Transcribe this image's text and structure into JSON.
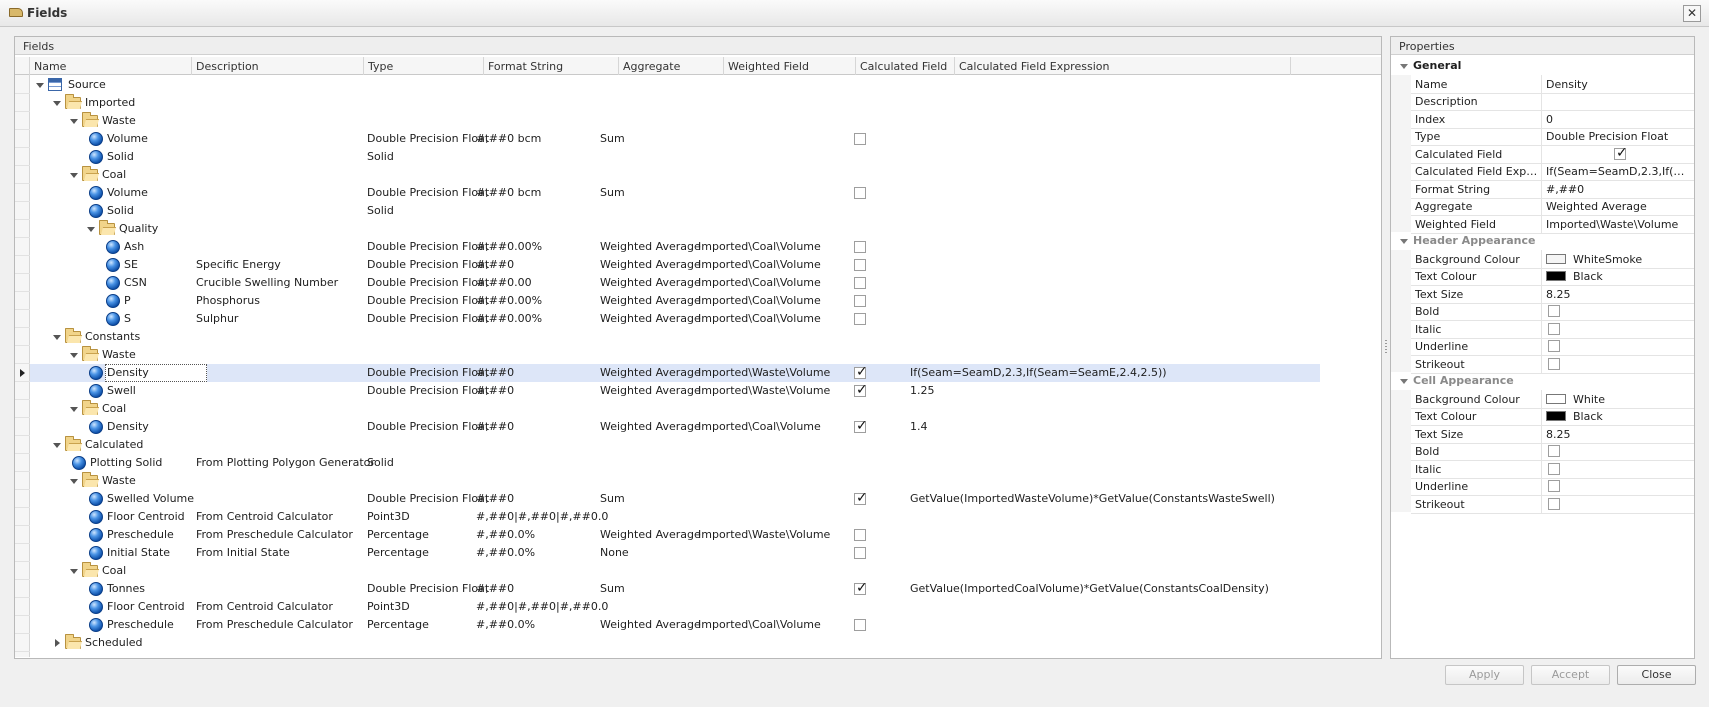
{
  "window": {
    "title": "Fields",
    "close_glyph": "✕"
  },
  "fields_panel": {
    "title": "Fields",
    "columns": [
      "Name",
      "Description",
      "Type",
      "Format String",
      "Aggregate",
      "Weighted Field",
      "Calculated Field",
      "Calculated Field Expression"
    ]
  },
  "tree_rows": [
    {
      "name": "Source",
      "level": 0,
      "kind": "table",
      "expander": "open"
    },
    {
      "name": "Imported",
      "level": 1,
      "kind": "folder",
      "expander": "open"
    },
    {
      "name": "Waste",
      "level": 2,
      "kind": "folder",
      "expander": "open"
    },
    {
      "name": "Volume",
      "level": 3,
      "kind": "field",
      "type": "Double Precision Float",
      "format": "#,##0 bcm",
      "aggregate": "Sum",
      "calc": false
    },
    {
      "name": "Solid",
      "level": 3,
      "kind": "field",
      "type": "Solid"
    },
    {
      "name": "Coal",
      "level": 2,
      "kind": "folder",
      "expander": "open"
    },
    {
      "name": "Volume",
      "level": 3,
      "kind": "field",
      "type": "Double Precision Float",
      "format": "#,##0 bcm",
      "aggregate": "Sum",
      "calc": false
    },
    {
      "name": "Solid",
      "level": 3,
      "kind": "field",
      "type": "Solid"
    },
    {
      "name": "Quality",
      "level": 3,
      "kind": "folder",
      "expander": "open"
    },
    {
      "name": "Ash",
      "level": 4,
      "kind": "field",
      "type": "Double Precision Float",
      "format": "#,##0.00%",
      "aggregate": "Weighted Average",
      "weighted": "Imported\\Coal\\Volume",
      "calc": false
    },
    {
      "name": "SE",
      "level": 4,
      "kind": "field",
      "description": "Specific Energy",
      "type": "Double Precision Float",
      "format": "#,##0",
      "aggregate": "Weighted Average",
      "weighted": "Imported\\Coal\\Volume",
      "calc": false
    },
    {
      "name": "CSN",
      "level": 4,
      "kind": "field",
      "description": "Crucible Swelling Number",
      "type": "Double Precision Float",
      "format": "#,##0.00",
      "aggregate": "Weighted Average",
      "weighted": "Imported\\Coal\\Volume",
      "calc": false
    },
    {
      "name": "P",
      "level": 4,
      "kind": "field",
      "description": "Phosphorus",
      "type": "Double Precision Float",
      "format": "#,##0.00%",
      "aggregate": "Weighted Average",
      "weighted": "Imported\\Coal\\Volume",
      "calc": false
    },
    {
      "name": "S",
      "level": 4,
      "kind": "field",
      "description": "Sulphur",
      "type": "Double Precision Float",
      "format": "#,##0.00%",
      "aggregate": "Weighted Average",
      "weighted": "Imported\\Coal\\Volume",
      "calc": false
    },
    {
      "name": "Constants",
      "level": 1,
      "kind": "folder",
      "expander": "open"
    },
    {
      "name": "Waste",
      "level": 2,
      "kind": "folder",
      "expander": "open"
    },
    {
      "name": "Density",
      "level": 3,
      "kind": "field",
      "type": "Double Precision Float",
      "format": "#,##0",
      "aggregate": "Weighted Average",
      "weighted": "Imported\\Waste\\Volume",
      "calc": true,
      "expression": "If(Seam=SeamD,2.3,If(Seam=SeamE,2.4,2.5))",
      "selected": true
    },
    {
      "name": "Swell",
      "level": 3,
      "kind": "field",
      "type": "Double Precision Float",
      "format": "#,##0",
      "aggregate": "Weighted Average",
      "weighted": "Imported\\Waste\\Volume",
      "calc": true,
      "expression": "1.25"
    },
    {
      "name": "Coal",
      "level": 2,
      "kind": "folder",
      "expander": "open"
    },
    {
      "name": "Density",
      "level": 3,
      "kind": "field",
      "type": "Double Precision Float",
      "format": "#,##0",
      "aggregate": "Weighted Average",
      "weighted": "Imported\\Coal\\Volume",
      "calc": true,
      "expression": "1.4"
    },
    {
      "name": "Calculated",
      "level": 1,
      "kind": "folder",
      "expander": "open"
    },
    {
      "name": "Plotting Solid",
      "level": 2,
      "kind": "field",
      "description": "From Plotting Polygon Generator",
      "type": "Solid"
    },
    {
      "name": "Waste",
      "level": 2,
      "kind": "folder",
      "expander": "open"
    },
    {
      "name": "Swelled Volume",
      "level": 3,
      "kind": "field",
      "type": "Double Precision Float",
      "format": "#,##0",
      "aggregate": "Sum",
      "calc": true,
      "expression": "GetValue(ImportedWasteVolume)*GetValue(ConstantsWasteSwell)"
    },
    {
      "name": "Floor Centroid",
      "level": 3,
      "kind": "field",
      "description": "From Centroid Calculator",
      "type": "Point3D",
      "format": "#,##0|#,##0|#,##0.0"
    },
    {
      "name": "Preschedule",
      "level": 3,
      "kind": "field",
      "description": "From Preschedule Calculator",
      "type": "Percentage",
      "format": "#,##0.0%",
      "aggregate": "Weighted Average",
      "weighted": "Imported\\Waste\\Volume",
      "calc": false
    },
    {
      "name": "Initial State",
      "level": 3,
      "kind": "field",
      "description": "From Initial State",
      "type": "Percentage",
      "format": "#,##0.0%",
      "aggregate": "None",
      "calc": false
    },
    {
      "name": "Coal",
      "level": 2,
      "kind": "folder",
      "expander": "open"
    },
    {
      "name": "Tonnes",
      "level": 3,
      "kind": "field",
      "type": "Double Precision Float",
      "format": "#,##0",
      "aggregate": "Sum",
      "calc": true,
      "expression": "GetValue(ImportedCoalVolume)*GetValue(ConstantsCoalDensity)"
    },
    {
      "name": "Floor Centroid",
      "level": 3,
      "kind": "field",
      "description": "From Centroid Calculator",
      "type": "Point3D",
      "format": "#,##0|#,##0|#,##0.0"
    },
    {
      "name": "Preschedule",
      "level": 3,
      "kind": "field",
      "description": "From Preschedule Calculator",
      "type": "Percentage",
      "format": "#,##0.0%",
      "aggregate": "Weighted Average",
      "weighted": "Imported\\Coal\\Volume",
      "calc": false
    },
    {
      "name": "Scheduled",
      "level": 1,
      "kind": "folder",
      "expander": "closed"
    }
  ],
  "properties_panel": {
    "title": "Properties",
    "groups": [
      {
        "title": "General",
        "rows": [
          {
            "name": "Name",
            "value": "Density"
          },
          {
            "name": "Description",
            "value": ""
          },
          {
            "name": "Index",
            "value": "0"
          },
          {
            "name": "Type",
            "value": "Double Precision Float"
          },
          {
            "name": "Calculated Field",
            "checkbox": true,
            "checked": true,
            "align": "center"
          },
          {
            "name": "Calculated Field Expre...",
            "value": "If(Seam=SeamD,2.3,If(Se..."
          },
          {
            "name": "Format String",
            "value": "#,##0"
          },
          {
            "name": "Aggregate",
            "value": "Weighted Average"
          },
          {
            "name": "Weighted Field",
            "value": "Imported\\Waste\\Volume"
          }
        ]
      },
      {
        "title": "Header Appearance",
        "rows": [
          {
            "name": "Background Colour",
            "value": "WhiteSmoke",
            "swatch": "#f5f5f5"
          },
          {
            "name": "Text Colour",
            "value": "Black",
            "swatch": "#000000"
          },
          {
            "name": "Text Size",
            "value": "8.25"
          },
          {
            "name": "Bold",
            "checkbox": true,
            "checked": false
          },
          {
            "name": "Italic",
            "checkbox": true,
            "checked": false
          },
          {
            "name": "Underline",
            "checkbox": true,
            "checked": false
          },
          {
            "name": "Strikeout",
            "checkbox": true,
            "checked": false
          }
        ]
      },
      {
        "title": "Cell Appearance",
        "rows": [
          {
            "name": "Background Colour",
            "value": "White",
            "swatch": "#ffffff"
          },
          {
            "name": "Text Colour",
            "value": "Black",
            "swatch": "#000000"
          },
          {
            "name": "Text Size",
            "value": "8.25"
          },
          {
            "name": "Bold",
            "checkbox": true,
            "checked": false
          },
          {
            "name": "Italic",
            "checkbox": true,
            "checked": false
          },
          {
            "name": "Underline",
            "checkbox": true,
            "checked": false
          },
          {
            "name": "Strikeout",
            "checkbox": true,
            "checked": false
          }
        ]
      }
    ]
  },
  "buttons": {
    "apply": {
      "label": "Apply",
      "enabled": false
    },
    "accept": {
      "label": "Accept",
      "enabled": false
    },
    "close": {
      "label": "Close",
      "enabled": true
    }
  },
  "colors": {
    "selected_row": "#dde6f8",
    "window_bg": "#f0f0f0"
  }
}
